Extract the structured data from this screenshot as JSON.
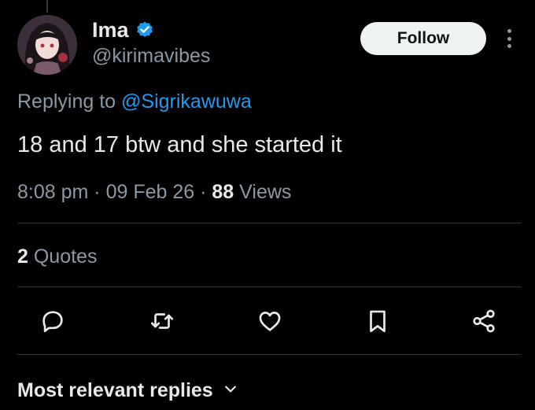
{
  "author": {
    "name": "Ima",
    "handle": "@kirimavibes",
    "verified_icon": "verified-badge-icon"
  },
  "follow_label": "Follow",
  "reply_context": {
    "prefix": "Replying to",
    "mention": "@Sigrikawuwa"
  },
  "tweet": {
    "text": "18 and 17 btw and she started it"
  },
  "meta": {
    "time": "8:08 pm",
    "sep1": "·",
    "date": "09 Feb 26",
    "sep2": "·",
    "views_count": "88",
    "views_label": "Views"
  },
  "stats": {
    "quotes_count": "2",
    "quotes_label": "Quotes"
  },
  "actions": [
    "reply-icon",
    "retweet-icon",
    "like-icon",
    "bookmark-icon",
    "share-icon"
  ],
  "replies_sort": {
    "label": "Most relevant replies",
    "icon": "chevron-down-icon"
  },
  "colors": {
    "background": "#000000",
    "text": "#e7e9ea",
    "secondary": "#8b98a5",
    "accent": "#1d9bf0",
    "button_bg": "#eff3f4"
  }
}
